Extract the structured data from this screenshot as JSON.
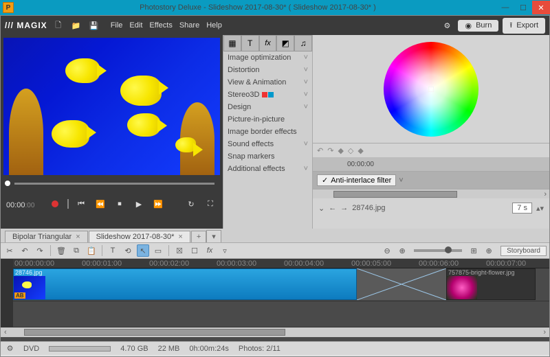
{
  "window": {
    "title": "Photostory Deluxe - Slideshow 2017-08-30* ( Slideshow 2017-08-30* )",
    "app_icon": "P"
  },
  "menubar": {
    "brand": "MAGIX",
    "file": "File",
    "edit": "Edit",
    "effects": "Effects",
    "share": "Share",
    "help": "Help",
    "burn": "Burn",
    "export": "Export"
  },
  "preview": {
    "time": "00:00",
    "sub": ":00"
  },
  "effects": {
    "items": [
      "Image optimization",
      "Distortion",
      "View & Animation",
      "Stereo3D",
      "Design",
      "Picture-in-picture",
      "Image border effects",
      "Sound effects",
      "Snap markers",
      "Additional effects"
    ]
  },
  "right": {
    "timecode": "00:00:00",
    "anti": "Anti-interlace filter",
    "file": "28746.jpg",
    "duration": "7 s"
  },
  "doc_tabs": {
    "t1": "Bipolar Triangular",
    "t2": "Slideshow 2017-08-30*"
  },
  "timeline": {
    "marks": [
      "00:00:00:00",
      "00:00:01:00",
      "00:00:02:00",
      "00:00:03:00",
      "00:00:04:00",
      "00:00:05:00",
      "00:00:06:00",
      "00:00:07:00"
    ],
    "clip1_label": "28746.jpg",
    "clip1_ab": "AB",
    "clip2_label": "757875-bright-flower.jpg",
    "storyboard": "Storyboard"
  },
  "status": {
    "dvd": "DVD",
    "disk": "4.70 GB",
    "mem": "22 MB",
    "dur": "0h:00m:24s",
    "photos": "Photos: 2/11"
  }
}
